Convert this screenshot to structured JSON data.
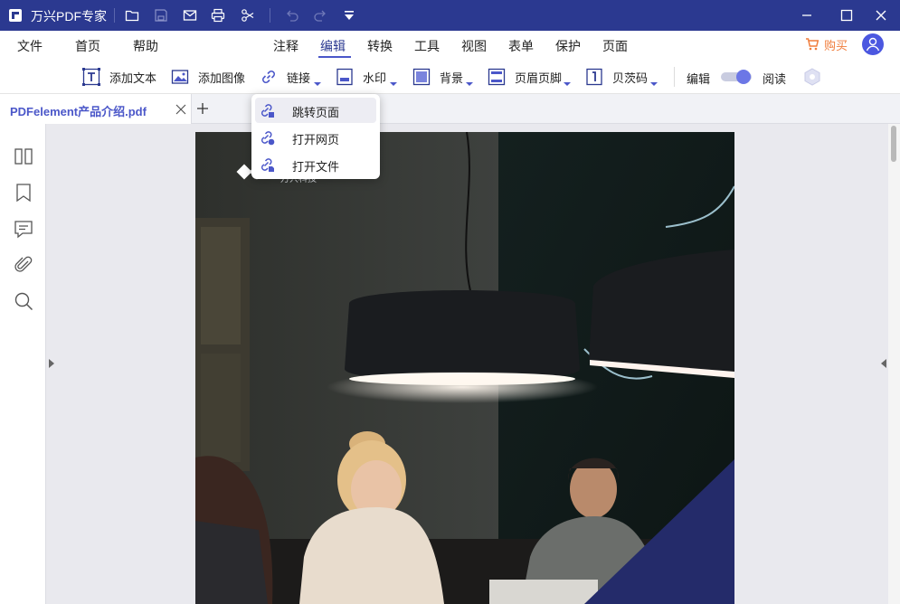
{
  "app": {
    "title": "万兴PDF专家"
  },
  "colors": {
    "titlebar": "#2b3990",
    "accent": "#4b57c9",
    "buy": "#f07d3c"
  },
  "menu": {
    "file": "文件",
    "home": "首页",
    "help": "帮助",
    "tabs": [
      "注释",
      "编辑",
      "转换",
      "工具",
      "视图",
      "表单",
      "保护",
      "页面"
    ],
    "active": "编辑",
    "buy": "购买"
  },
  "toolbar": {
    "add_text": "添加文本",
    "add_image": "添加图像",
    "link": "链接",
    "watermark": "水印",
    "background": "背景",
    "header_footer": "页眉页脚",
    "bates": "贝茨码",
    "edit_mode": "编辑",
    "read_mode": "阅读"
  },
  "document_tab": {
    "label": "PDFelement产品介绍.pdf"
  },
  "link_menu": {
    "items": [
      "跳转页面",
      "打开网页",
      "打开文件"
    ],
    "highlighted": "跳转页面"
  },
  "page": {
    "logo_text": "万兴科技"
  }
}
